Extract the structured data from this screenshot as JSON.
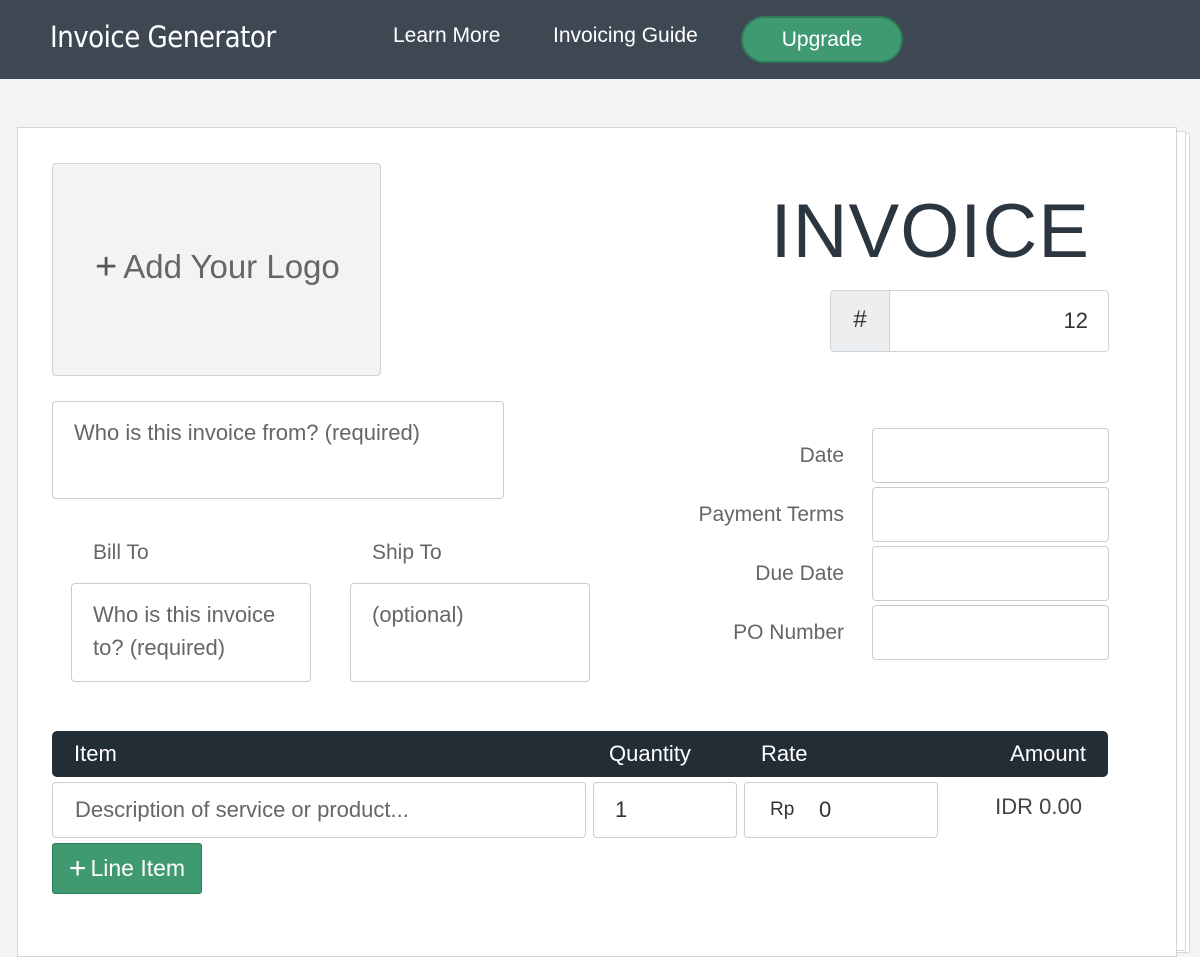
{
  "nav": {
    "brand": "Invoice Generator",
    "learn_more": "Learn More",
    "guide": "Invoicing Guide",
    "upgrade": "Upgrade"
  },
  "invoice": {
    "logo_label": "Add Your Logo",
    "title": "INVOICE",
    "number_prefix": "#",
    "number": "12",
    "from_placeholder": "Who is this invoice from? (required)",
    "bill_to_label": "Bill To",
    "ship_to_label": "Ship To",
    "bill_to_placeholder": "Who is this invoice to? (required)",
    "ship_to_placeholder": "(optional)",
    "meta": [
      {
        "label": "Date"
      },
      {
        "label": "Payment Terms"
      },
      {
        "label": "Due Date"
      },
      {
        "label": "PO Number"
      }
    ]
  },
  "table": {
    "headers": {
      "item": "Item",
      "quantity": "Quantity",
      "rate": "Rate",
      "amount": "Amount"
    },
    "row": {
      "description_placeholder": "Description of service or product...",
      "quantity": "1",
      "currency_symbol": "Rp",
      "rate": "0",
      "amount": "IDR 0.00"
    },
    "add_line_label": "Line Item"
  },
  "colors": {
    "nav_bg": "#3d4852",
    "accent_green": "#3f9a71",
    "table_header": "#232d36"
  }
}
